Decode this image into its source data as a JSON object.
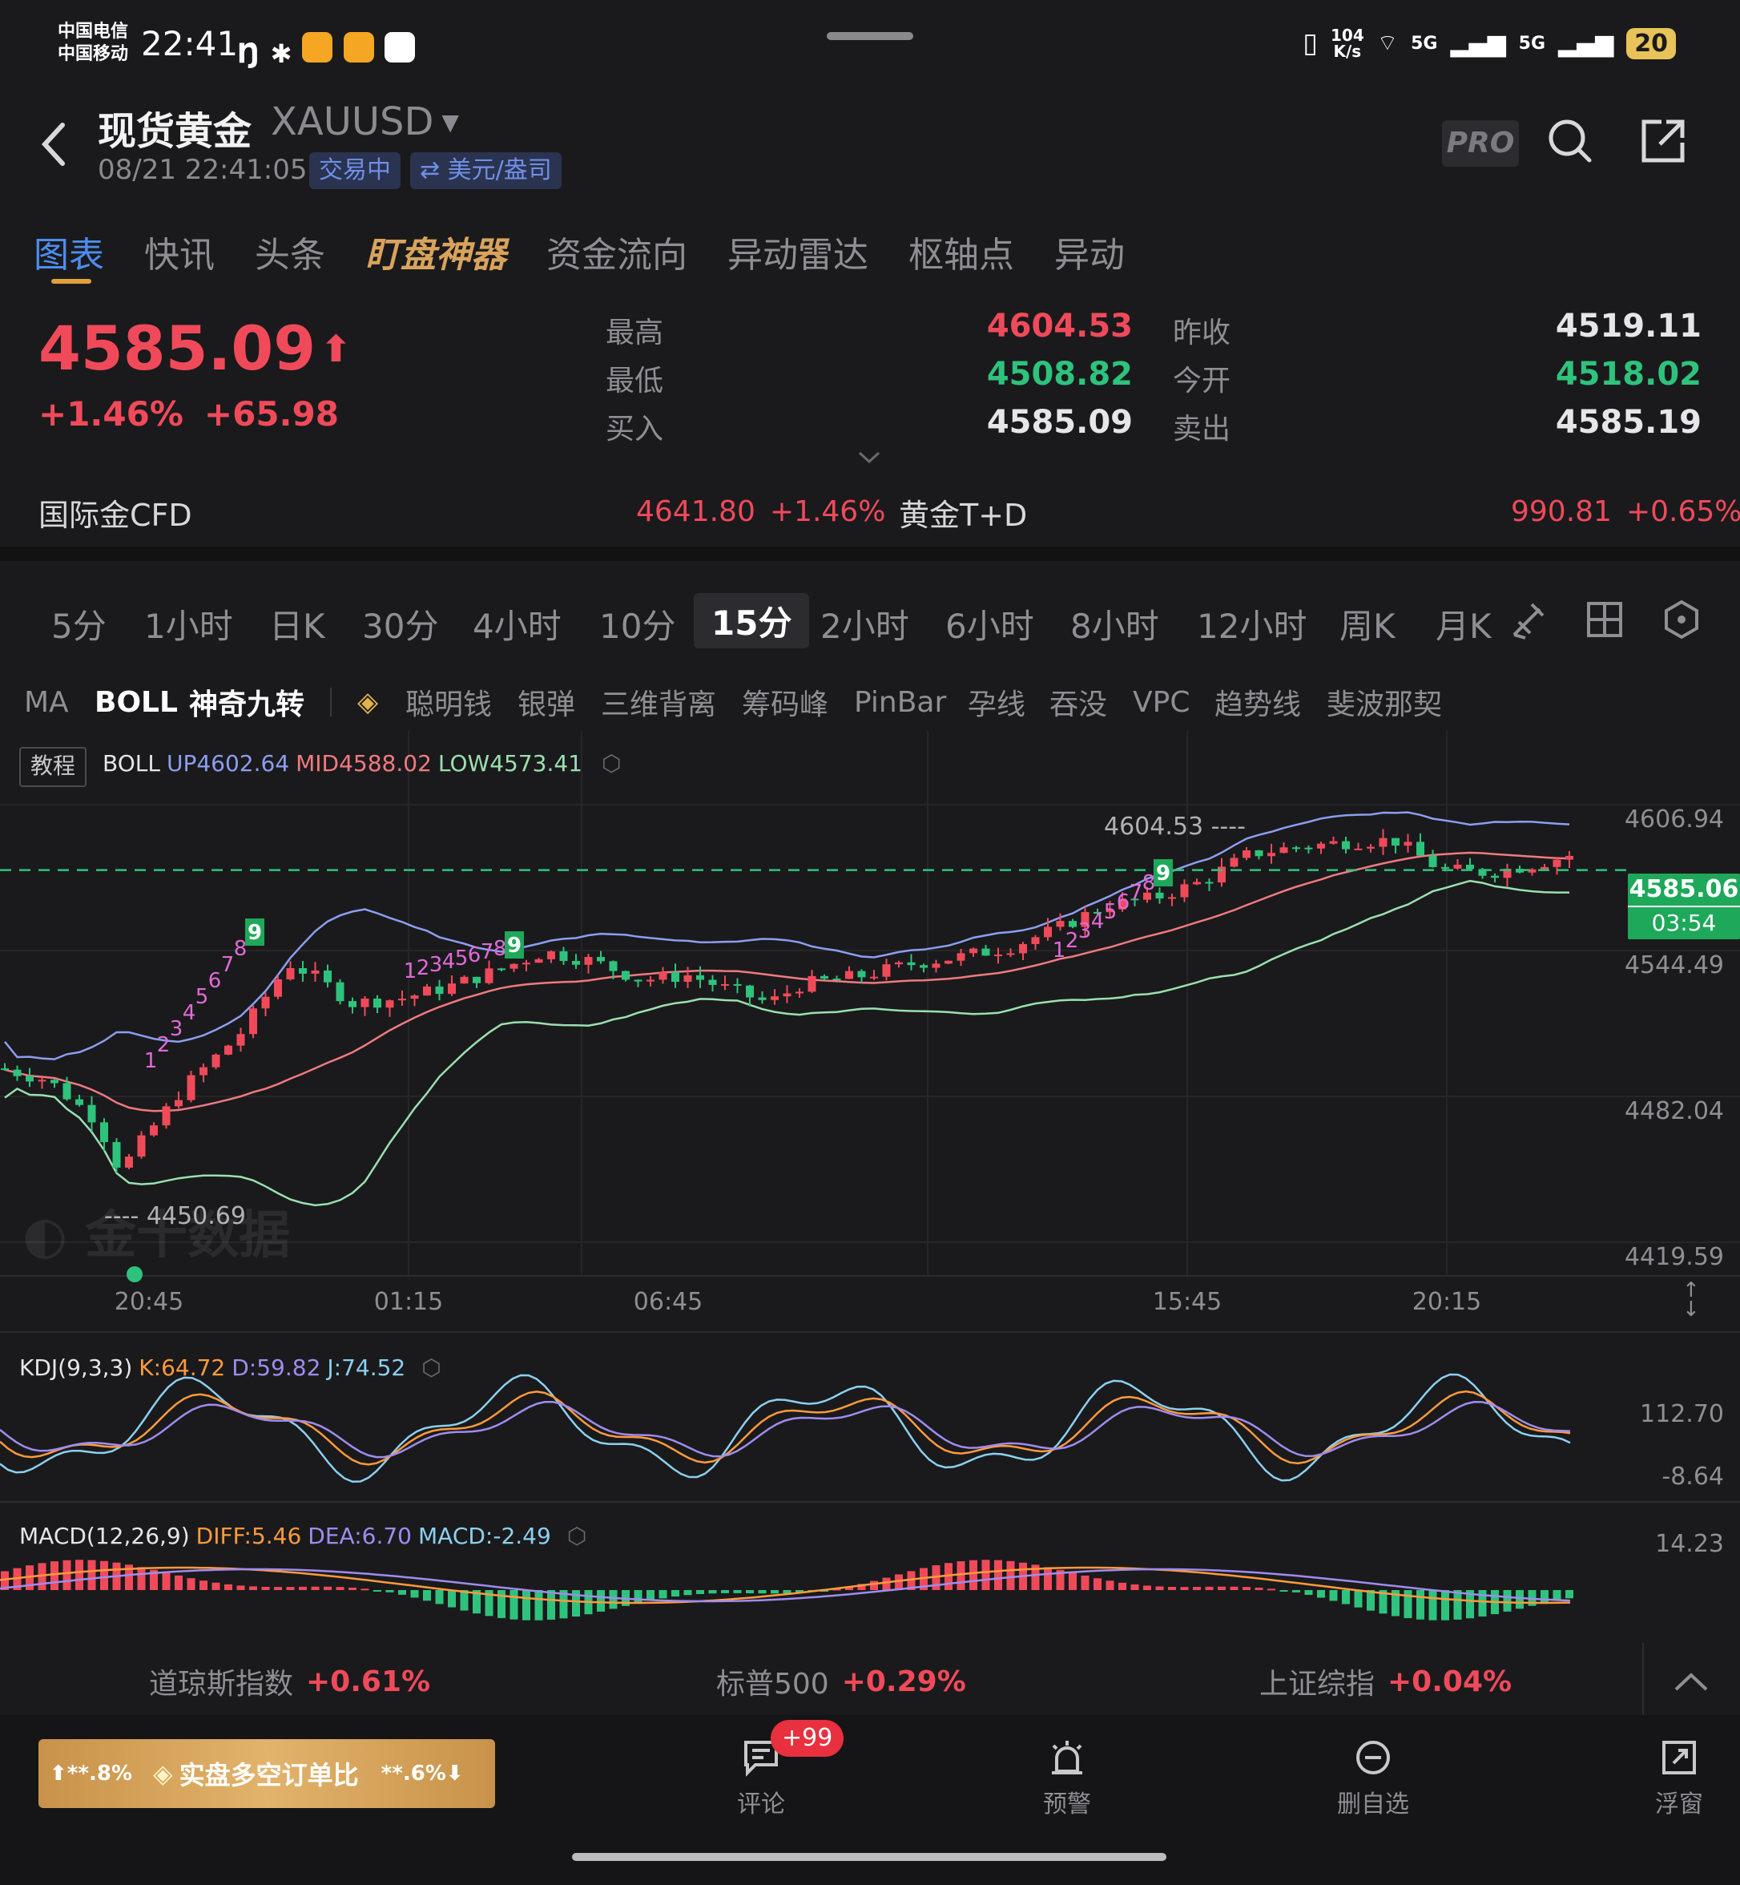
{
  "status_bar": {
    "carrier1": "中国电信",
    "carrier2": "中国移动",
    "time": "22:41",
    "net_speed_value": "104",
    "net_speed_unit": "K/s",
    "wifi": "7",
    "sig1": "5G",
    "sig2": "5G",
    "battery": "20"
  },
  "header": {
    "title": "现货黄金",
    "symbol": "XAUUSD",
    "timestamp": "08/21 22:41:05",
    "status_tag": "交易中",
    "unit_tag": "⇄ 美元/盎司",
    "pro_label": "PRO"
  },
  "tabs": [
    "图表",
    "快讯",
    "头条",
    "盯盘神器",
    "资金流向",
    "异动雷达",
    "枢轴点",
    "异动"
  ],
  "quote": {
    "price": "4585.09",
    "arrow": "⬆",
    "change_pct": "+1.46%",
    "change_abs": "+65.98",
    "high_label": "最高",
    "high": "4604.53",
    "low_label": "最低",
    "low": "4508.82",
    "bid_label": "买入",
    "bid": "4585.09",
    "prev_close_label": "昨收",
    "prev_close": "4519.11",
    "open_label": "今开",
    "open": "4518.02",
    "ask_label": "卖出",
    "ask": "4585.19"
  },
  "related": {
    "cfd_label": "国际金CFD",
    "cfd_price": "4641.80",
    "cfd_pct": "+1.46%",
    "td_label": "黄金T+D",
    "td_price": "990.81",
    "td_pct": "+0.65%"
  },
  "periods": [
    "5分",
    "1小时",
    "日K",
    "30分",
    "4小时",
    "10分",
    "15分",
    "2小时",
    "6小时",
    "8小时",
    "12小时",
    "周K",
    "月K"
  ],
  "active_period": "15分",
  "indicators": [
    "MA",
    "BOLL",
    "神奇九转",
    "聪明钱",
    "银弹",
    "三维背离",
    "筹码峰",
    "PinBar",
    "孕线",
    "吞没",
    "VPC",
    "趋势线",
    "斐波那契"
  ],
  "boll_legend": {
    "tutorial": "教程",
    "name": "BOLL",
    "up": "UP4602.64",
    "mid": "MID4588.02",
    "low": "LOW4573.41"
  },
  "price_axis": [
    "4606.94",
    "4544.49",
    "4482.04",
    "4419.59"
  ],
  "current_price_tag": "4585.06",
  "countdown": "03:54",
  "high_marker": "4604.53",
  "low_marker": "4450.69",
  "watermark": "金十数据",
  "time_axis": [
    "20:45",
    "01:15",
    "06:45",
    "15:45",
    "20:15"
  ],
  "nine_turn_labels": [
    "1",
    "2",
    "3",
    "4",
    "5",
    "6",
    "7",
    "8",
    "9"
  ],
  "kdj_legend": {
    "name": "KDJ(9,3,3)",
    "k": "K:64.72",
    "d": "D:59.82",
    "j": "J:74.52"
  },
  "kdj_axis": [
    "112.70",
    "-8.64"
  ],
  "macd_legend": {
    "name": "MACD(12,26,9)",
    "diff": "DIFF:5.46",
    "dea": "DEA:6.70",
    "macd": "MACD:-2.49"
  },
  "macd_axis": [
    "14.23"
  ],
  "indices": [
    {
      "name": "道琼斯指数",
      "pct": "+0.61%"
    },
    {
      "name": "标普500",
      "pct": "+0.29%"
    },
    {
      "name": "上证综指",
      "pct": "+0.04%"
    }
  ],
  "bottom_nav": {
    "gold_left": "⬆**.8%",
    "gold_label": "实盘多空订单比",
    "gold_right": "**.6%⬇",
    "comment": "评论",
    "comment_badge": "+99",
    "alert": "预警",
    "remove": "删自选",
    "float": "浮窗"
  },
  "colors": {
    "up": "#f04a5a",
    "down": "#2ec37c",
    "accent": "#4d8df0",
    "boll_up": "#8c9ef0",
    "boll_mid": "#f07a80",
    "boll_low": "#9be0b0"
  }
}
